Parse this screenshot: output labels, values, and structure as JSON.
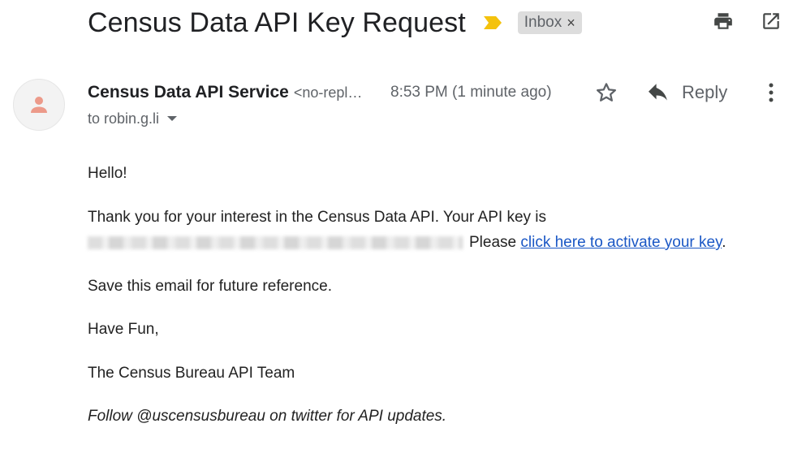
{
  "email": {
    "subject": "Census Data API Key Request",
    "label": "Inbox",
    "label_remove": "×",
    "sender": {
      "name": "Census Data API Service",
      "email_truncated": "<no-repl…"
    },
    "timestamp": "8:53 PM (1 minute ago)",
    "reply_label": "Reply",
    "to_line": "to robin.g.li",
    "body": {
      "greeting": "Hello!",
      "line1": "Thank you for your interest in the Census Data API. Your API key is",
      "please_text": "Please",
      "activate_link": "click here to activate your key",
      "period": ".",
      "save_line": "Save this email for future reference.",
      "have_fun": "Have Fun,",
      "signature": "The Census Bureau API Team",
      "follow_line": "Follow @uscensusbureau on twitter for API updates."
    }
  },
  "icons": {
    "importance": "importance-marker-icon",
    "print": "print-icon",
    "open_new_window": "open-in-new-window-icon",
    "avatar": "person-icon",
    "star": "star-icon",
    "reply": "reply-arrow-icon",
    "more": "more-vert-icon",
    "caret": "caret-down-icon"
  },
  "colors": {
    "importance_marker": "#f4c20d",
    "link": "#1a57c5",
    "chip_bg": "#dddddd",
    "avatar_icon": "#ec9a8a",
    "muted_text": "#5f6368"
  },
  "redacted_api_key": true
}
